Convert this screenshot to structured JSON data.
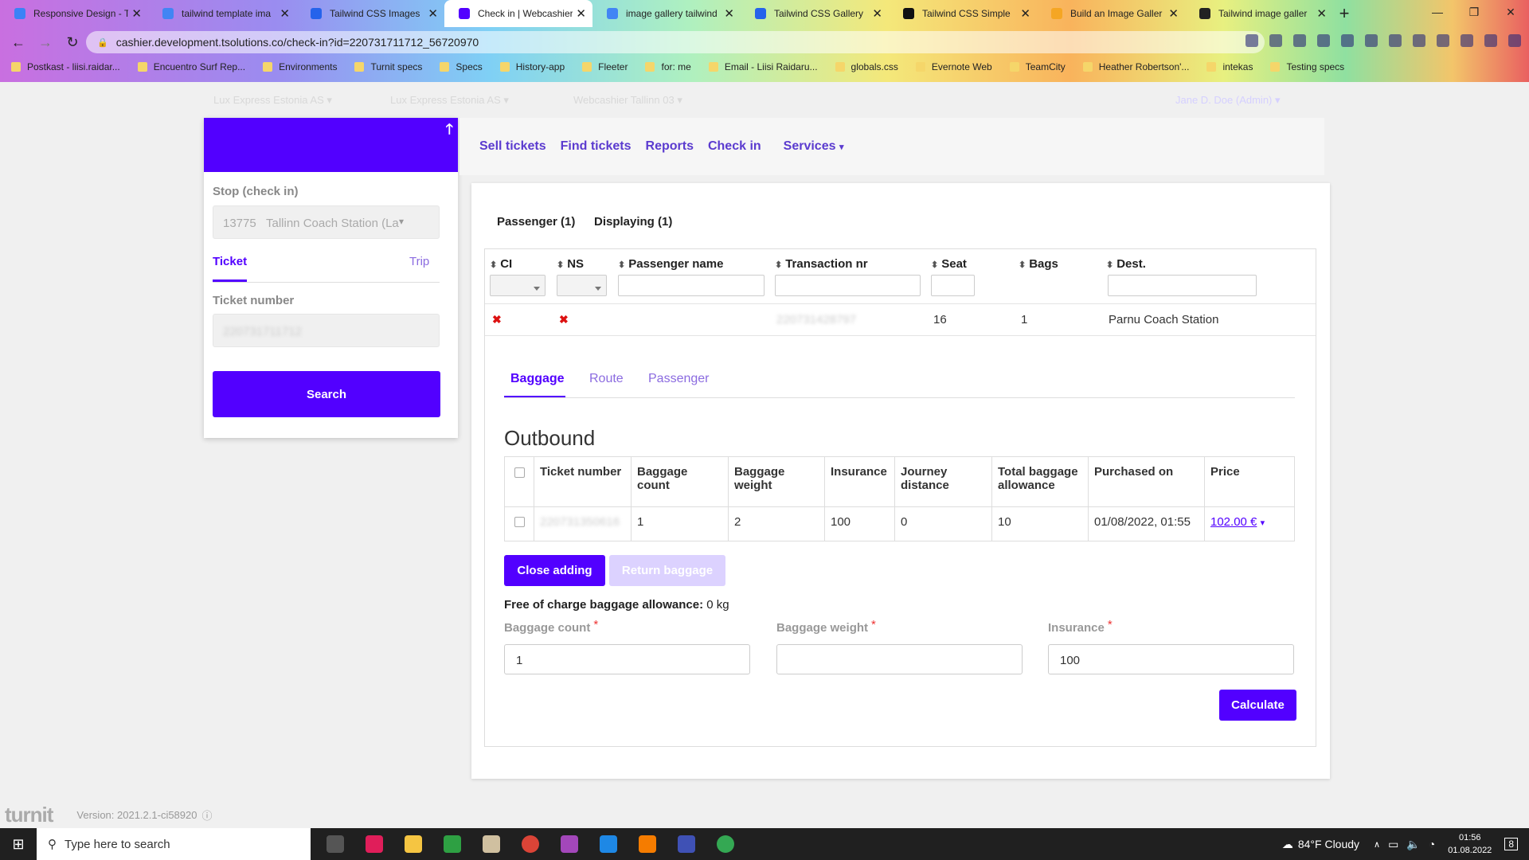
{
  "browser": {
    "tabs": [
      {
        "title": "Responsive Design - T",
        "active": false,
        "color": "#3b82f6"
      },
      {
        "title": "tailwind template ima",
        "active": false,
        "color": "#4285f4"
      },
      {
        "title": "Tailwind CSS Images",
        "active": false,
        "color": "#2563eb"
      },
      {
        "title": "Check in | Webcashier",
        "active": true,
        "color": "#5200ff"
      },
      {
        "title": "image gallery tailwind",
        "active": false,
        "color": "#4285f4"
      },
      {
        "title": "Tailwind CSS Gallery",
        "active": false,
        "color": "#2563eb"
      },
      {
        "title": "Tailwind CSS Simple",
        "active": false,
        "color": "#111111"
      },
      {
        "title": "Build an Image Galler",
        "active": false,
        "color": "#f5a623"
      },
      {
        "title": "Tailwind image galler",
        "active": false,
        "color": "#222222"
      }
    ],
    "url": "cashier.development.tsolutions.co/check-in?id=220731711712_56720970",
    "bookmarks": [
      "Postkast - liisi.raidar...",
      "Encuentro Surf Rep...",
      "Environments",
      "Turnit specs",
      "Specs",
      "History-app",
      "Fleeter",
      "for: me",
      "Email - Liisi Raidaru...",
      "globals.css",
      "Evernote Web",
      "TeamCity",
      "Heather Robertson'...",
      "intekas",
      "Testing specs"
    ]
  },
  "topbar": {
    "dropdowns": [
      "Lux Express Estonia AS",
      "Lux Express Estonia AS",
      "Webcashier Tallinn 03"
    ],
    "user": "Jane D. Doe (Admin)"
  },
  "sidebar": {
    "stop_label": "Stop (check in)",
    "stop_code": "13775",
    "stop_name": "Tallinn Coach Station (La",
    "tab_ticket": "Ticket",
    "tab_trip": "Trip",
    "ticket_label": "Ticket number",
    "ticket_value": "220731711712",
    "search_label": "Search"
  },
  "nav": [
    "Sell tickets",
    "Find tickets",
    "Reports",
    "Check in",
    "Services"
  ],
  "main": {
    "sub_passenger": "Passenger (1)",
    "sub_displaying": "Displaying (1)",
    "columns": [
      "CI",
      "NS",
      "Passenger name",
      "Transaction nr",
      "Seat",
      "Bags",
      "Dest."
    ],
    "row": {
      "transaction": "220731428797",
      "seat": "16",
      "bags": "1",
      "dest": "Parnu Coach Station"
    },
    "inner_tabs": [
      "Baggage",
      "Route",
      "Passenger"
    ],
    "section_title": "Outbound",
    "bag_headers": [
      "Ticket number",
      "Baggage count",
      "Baggage weight",
      "Insurance",
      "Journey distance",
      "Total baggage allowance",
      "Purchased on",
      "Price"
    ],
    "bag_row": {
      "ticket": "220731350616",
      "count": "1",
      "weight": "2",
      "insurance": "100",
      "distance": "0",
      "allowance": "10",
      "purchased": "01/08/2022, 01:55",
      "price": "102.00 €"
    },
    "close_adding": "Close adding",
    "return_baggage": "Return baggage",
    "free_label": "Free of charge baggage allowance:",
    "free_value": "0 kg",
    "form": {
      "count_label": "Baggage count",
      "count_value": "1",
      "weight_label": "Baggage weight",
      "weight_value": "",
      "insurance_label": "Insurance",
      "insurance_value": "100"
    },
    "calculate": "Calculate"
  },
  "footer": {
    "logo": "turnit",
    "version": "Version: 2021.2.1-ci58920"
  },
  "taskbar": {
    "search_placeholder": "Type here to search",
    "weather": "84°F Cloudy",
    "time": "01:56",
    "date": "01.08.2022",
    "notif": "8"
  },
  "colors": {
    "brand": "#5200ff",
    "link": "#5b3bcf",
    "error": "#dd1111",
    "disabled": "#dcd2ff"
  }
}
